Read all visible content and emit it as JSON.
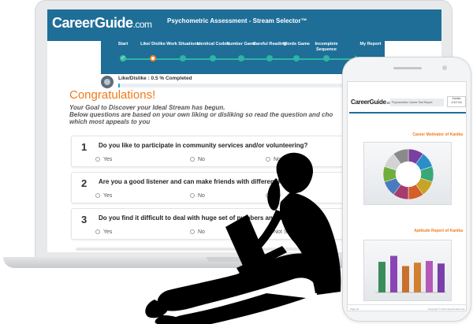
{
  "laptop": {
    "logo_main": "CareerGuide",
    "logo_suffix": ".com",
    "test_title": "Psychometric Assessment - Stream Selector™",
    "steps": [
      {
        "label": "Start",
        "state": "done"
      },
      {
        "label": "Like/ Dislike",
        "state": "active"
      },
      {
        "label": "Work Situations",
        "state": "pending"
      },
      {
        "label": "Identical Codes",
        "state": "pending"
      },
      {
        "label": "Number Game",
        "state": "pending"
      },
      {
        "label": "Careful Reading",
        "state": "pending"
      },
      {
        "label": "Words Game",
        "state": "pending"
      },
      {
        "label": "Incomplete Sequence",
        "state": "pending"
      },
      {
        "label": "My Report",
        "state": "pending"
      }
    ],
    "progress_label": "Like/Dislike : 0.5 % Completed",
    "progress_percent": 0.5,
    "congrats": "Congratulations!",
    "intro_line1": "Your Goal to Discover your Ideal Stream has begun.",
    "intro_line2": "Below questions are based on your own liking or disliking so read the question and cho",
    "intro_line3": "which most appeals to you",
    "questions": [
      {
        "num": "1",
        "text": "Do you like to participate in community services and/or volunteering?",
        "options": [
          "Yes",
          "No",
          "Not Sure"
        ]
      },
      {
        "num": "2",
        "text": "Are you a good listener and can make friends with different kinds",
        "options": [
          "Yes",
          "No",
          "No"
        ]
      },
      {
        "num": "3",
        "text": "Do you find it difficult to deal with huge set of numbers and data?",
        "options": [
          "Yes",
          "No",
          "Not Sure"
        ]
      }
    ]
  },
  "phone": {
    "logo_main": "CareerGuide",
    "logo_suffix": ".com",
    "report_title": "Psychometric Career Test Report",
    "meta_name": "Kanika",
    "meta_date": "1/1/2 KA",
    "section1_title": "Career Motivator of Kanika",
    "section2_title": "Aptitude Report of Kanika",
    "footer_left": "Page 01",
    "footer_right": "Copyright © www.CareerGuide.com",
    "donut_colors": [
      "#7b3fa0",
      "#2a8fc9",
      "#3aa876",
      "#c7a326",
      "#d45f2a",
      "#a63b6e",
      "#4b7bbf",
      "#6fae3b",
      "#d3d3d3",
      "#8a8a8a"
    ],
    "bar_colors": [
      "#3a8d5a",
      "#8a45b5",
      "#c8702c",
      "#d08030",
      "#b35ab8",
      "#7a3fa8"
    ]
  },
  "colors": {
    "brand_blue": "#1f6e98",
    "accent_orange": "#f07a1a",
    "step_teal": "#2fb4a3"
  }
}
